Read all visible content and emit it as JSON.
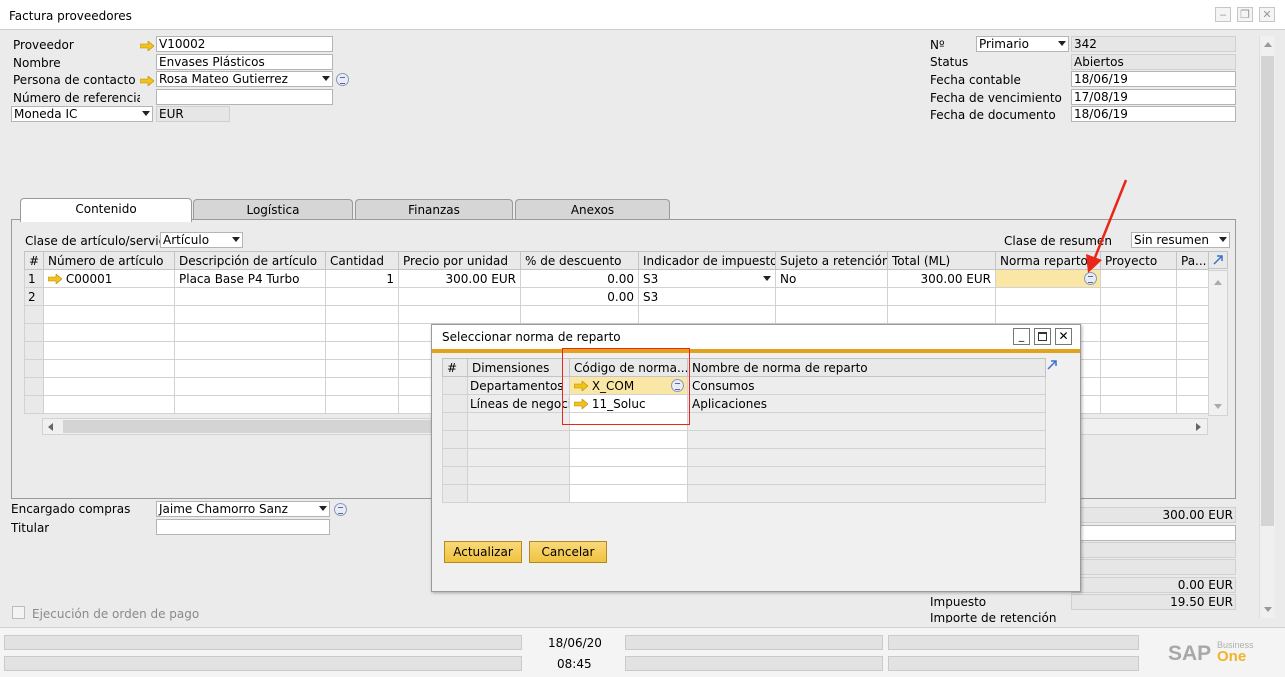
{
  "window": {
    "title": "Factura proveedores"
  },
  "header_left": {
    "proveedor_label": "Proveedor",
    "proveedor_value": "V10002",
    "nombre_label": "Nombre",
    "nombre_value": "Envases Plásticos",
    "contacto_label": "Persona de contacto",
    "contacto_value": "Rosa Mateo Gutierrez",
    "referencia_label": "Número de referencia d",
    "referencia_value": "",
    "moneda_label": "Moneda IC",
    "moneda_value": "EUR"
  },
  "header_right": {
    "numero_label": "Nº",
    "serie_value": "Primario",
    "numero_value": "342",
    "status_label": "Status",
    "status_value": "Abiertos",
    "fecha_contable_label": "Fecha contable",
    "fecha_contable_value": "18/06/19",
    "fecha_venc_label": "Fecha de vencimiento",
    "fecha_venc_value": "17/08/19",
    "fecha_doc_label": "Fecha de documento",
    "fecha_doc_value": "18/06/19"
  },
  "tabs": [
    "Contenido",
    "Logística",
    "Finanzas",
    "Anexos"
  ],
  "content": {
    "clase_label": "Clase de artículo/servicio",
    "clase_value": "Artículo",
    "resumen_label": "Clase de resumen",
    "resumen_value": "Sin resumen",
    "columns": [
      "#",
      "Número de artículo",
      "Descripción de artículo",
      "Cantidad",
      "Precio por unidad",
      "% de descuento",
      "Indicador de impuestos",
      "Sujeto a retención",
      "Total (ML)",
      "Norma reparto",
      "Proyecto",
      "Pa..."
    ],
    "rows": [
      {
        "n": "1",
        "articulo": "C00001",
        "descripcion": "Placa Base P4 Turbo",
        "cantidad": "1",
        "precio": "300.00 EUR",
        "descuento": "0.00",
        "impuesto": "S3",
        "retencion": "No",
        "total": "300.00 EUR"
      },
      {
        "n": "2",
        "articulo": "",
        "descripcion": "",
        "cantidad": "",
        "precio": "",
        "descuento": "0.00",
        "impuesto": "S3",
        "retencion": "",
        "total": ""
      }
    ]
  },
  "footer_left": {
    "encargado_label": "Encargado compras",
    "encargado_value": "Jaime Chamorro Sanz",
    "titular_label": "Titular",
    "titular_value": "",
    "ejecucion_label": "Ejecución de orden de pago"
  },
  "summary": {
    "total_antes": "300.00 EUR",
    "descuento": "0.00 EUR",
    "impuesto_label": "Impuesto",
    "impuesto_value": "19.50 EUR",
    "retencion_label": "Importe de retención"
  },
  "dialog": {
    "title": "Seleccionar norma de reparto",
    "columns": [
      "#",
      "Dimensiones",
      "Código de norma...",
      "Nombre de norma de reparto"
    ],
    "rows": [
      {
        "dimension": "Departamentos",
        "codigo": "X_COM",
        "nombre": "Consumos"
      },
      {
        "dimension": "Líneas de negocio",
        "codigo": "11_Soluc",
        "nombre": "Aplicaciones"
      }
    ],
    "update_button": "Actualizar",
    "cancel_button": "Cancelar"
  },
  "statusbar": {
    "date": "18/06/20",
    "time": "08:45",
    "brand_sap": "SAP",
    "brand_business": "Business",
    "brand_one": "One"
  },
  "colors": {
    "accent": "#e3a21e",
    "annotation_red": "#e8261a",
    "highlight_cell": "#fbe7a5"
  }
}
